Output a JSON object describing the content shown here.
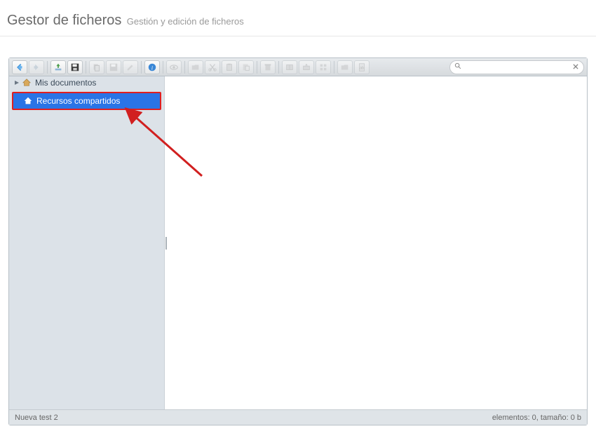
{
  "header": {
    "title": "Gestor de ficheros",
    "subtitle": "Gestión y edición de ficheros"
  },
  "toolbar": {
    "back": "Atrás",
    "forward": "Adelante",
    "upload": "Subir",
    "download": "Descargar",
    "copy_btn": "Copiar",
    "save": "Guardar",
    "edit": "Editar",
    "info": "Información",
    "preview": "Vista previa",
    "open": "Abrir",
    "cut": "Cortar",
    "copy": "Copiar",
    "paste": "Pegar",
    "delete": "Eliminar",
    "compress": "Comprimir",
    "extract": "Extraer",
    "select_all": "Seleccionar todo",
    "new_folder": "Nueva carpeta",
    "new_file": "Nuevo fichero"
  },
  "search": {
    "placeholder": ""
  },
  "sidebar": {
    "items": [
      {
        "label": "Mis documentos",
        "expandable": true,
        "selected": false
      },
      {
        "label": "Recursos compartidos",
        "expandable": false,
        "selected": true
      }
    ]
  },
  "status": {
    "path": "Nueva test 2",
    "summary": "elementos: 0, tamaño: 0 b"
  },
  "colors": {
    "accent": "#2a74e6",
    "highlight_border": "#e11f1f",
    "arrow": "#d11f1f"
  }
}
